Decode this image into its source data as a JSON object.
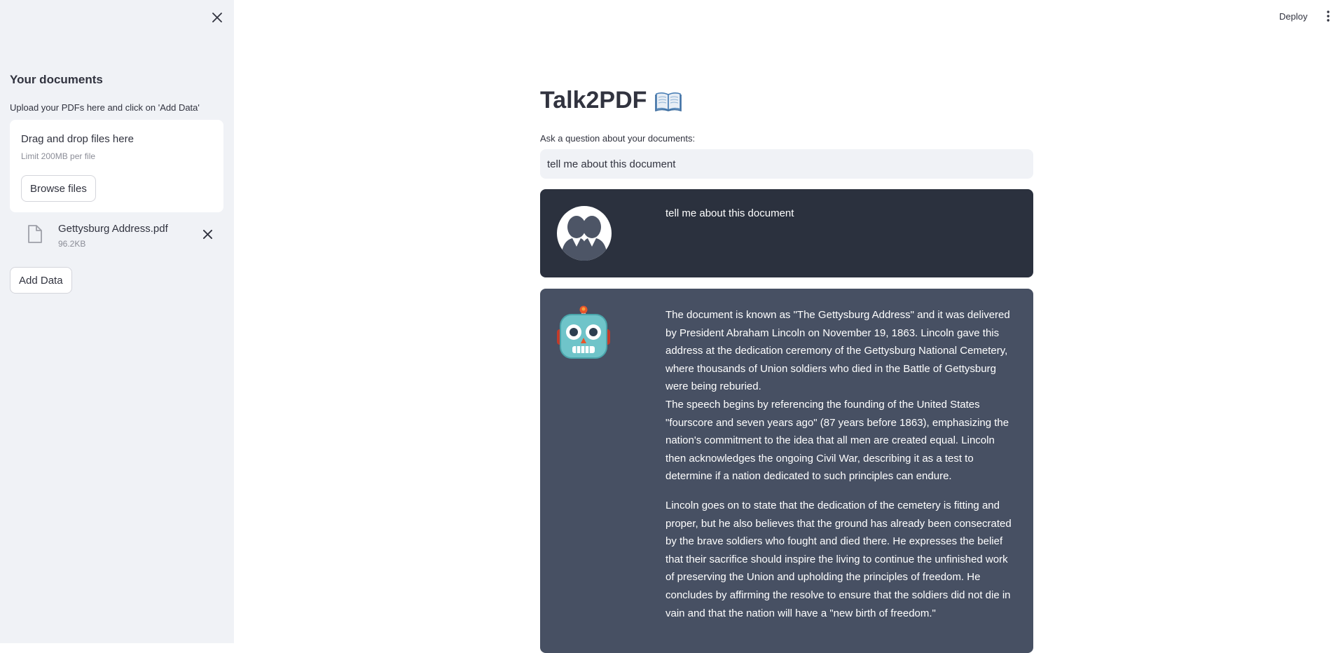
{
  "sidebar": {
    "title": "Your documents",
    "upload_label": "Upload your PDFs here and click on 'Add Data'",
    "dropzone": {
      "title": "Drag and drop files here",
      "limit": "Limit 200MB per file",
      "browse_label": "Browse files"
    },
    "files": [
      {
        "name": "Gettysburg Address.pdf",
        "size": "96.2KB"
      }
    ],
    "add_data_label": "Add Data"
  },
  "header": {
    "deploy_label": "Deploy"
  },
  "main": {
    "title": "Talk2PDF",
    "title_icon": "open-book-icon",
    "question_label": "Ask a question about your documents:",
    "question_value": "tell me about this document",
    "chat": {
      "user_message": "tell me about this document",
      "bot_paragraphs": [
        "The document is known as \"The Gettysburg Address\" and it was delivered by President Abraham Lincoln on November 19, 1863. Lincoln gave this address at the dedication ceremony of the Gettysburg National Cemetery, where thousands of Union soldiers who died in the Battle of Gettysburg were being reburied.",
        "The speech begins by referencing the founding of the United States \"fourscore and seven years ago\" (87 years before 1863), emphasizing the nation's commitment to the idea that all men are created equal. Lincoln then acknowledges the ongoing Civil War, describing it as a test to determine if a nation dedicated to such principles can endure.",
        "Lincoln goes on to state that the dedication of the cemetery is fitting and proper, but he also believes that the ground has already been consecrated by the brave soldiers who fought and died there. He expresses the belief that their sacrifice should inspire the living to continue the unfinished work of preserving the Union and upholding the principles of freedom. He concludes by affirming the resolve to ensure that the soldiers did not die in vain and that the nation will have a \"new birth of freedom.\""
      ]
    }
  },
  "colors": {
    "sidebar_bg": "#f0f2f6",
    "user_bubble_bg": "#2b313e",
    "bot_bubble_bg": "#475063",
    "text": "#31333f"
  }
}
